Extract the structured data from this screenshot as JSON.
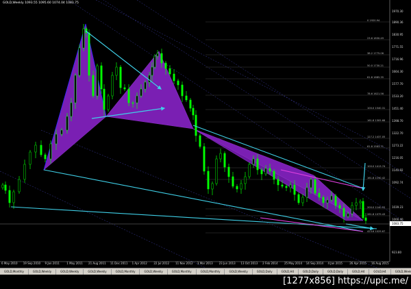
{
  "window": {
    "chart_title": "GOLD,Weekly 1093.55 1095.60 1074.04 1083.75",
    "current_price": "1083.75"
  },
  "y_axis": {
    "ticks": [
      "1970.30",
      "1890.36",
      "1830.95",
      "1771.55",
      "1716.96",
      "1664.30",
      "1577.70",
      "1533.20",
      "1451.40",
      "1398.70",
      "1322.70",
      "1273.22",
      "1216.05",
      "1140.92",
      "1092.74",
      "1083.75",
      "1039.23",
      "1000.40",
      "923.80"
    ]
  },
  "x_axis": {
    "ticks": [
      "6 May 2010",
      "19 Sep 2010",
      "9 Jan 2011",
      "1 May 2011",
      "21 Aug 2011",
      "11 Dec 2011",
      "1 Apr 2012",
      "22 Jul 2012",
      "11 Nov 2012",
      "3 Mar 2013",
      "23 Jun 2013",
      "13 Oct 2013",
      "2 Feb 2014",
      "25 May 2014",
      "14 Sep 2014",
      "4 Jan 2015",
      "26 Apr 2015",
      "16 Aug 2015"
    ]
  },
  "fib_levels": [
    "0 1920.94",
    "23.6 1830.49",
    "38.2 1775.06",
    "50.0 1730.21",
    "61.8 1685.35",
    "78.6 1621.56",
    "100.0 1540.31",
    "161.8 1305.68",
    "127.2 1437.05",
    "61.8 1583.71",
    "100.0 1413.74",
    "161.8 1190.42",
    "200.0 1140.55",
    "261.8 1079.43",
    "423.6 1029.67"
  ],
  "tabs": [
    "GOLD,Monthly",
    "GOLD,Weekly",
    "GOLD,Weekly",
    "GOLD,Weekly",
    "GOLD,Monthly",
    "GOLD,Weekly",
    "GOLD,Monthly",
    "GOLD,Monthly",
    "GOLD,Weekly",
    "GOLD,Daily",
    "GOLD,H4",
    "GOLD,Daily",
    "GOLD,Daily",
    "GOLD,H4",
    "GOLD,H4",
    "GOLD,Weekly",
    "GOLD,H4",
    "GOLD,Weekly"
  ],
  "active_tab_index": 17,
  "watermark": "[1277x856] https://upic.me/",
  "colors": {
    "background": "#000000",
    "candles": "#00ff00",
    "pattern_fill": "#7a1fb3",
    "trendlines": "#3fd0e8",
    "magenta_lines": "#e040e0",
    "grid_diag": "#3a3aa0"
  },
  "chart_data": {
    "type": "candlestick",
    "instrument": "GOLD",
    "timeframe": "Weekly",
    "ohlc_last": {
      "open": 1093.55,
      "high": 1095.6,
      "low": 1074.04,
      "close": 1083.75
    },
    "y_range": [
      923.8,
      1970.3
    ],
    "x_range": [
      "6 May 2010",
      "16 Aug 2015"
    ]
  }
}
